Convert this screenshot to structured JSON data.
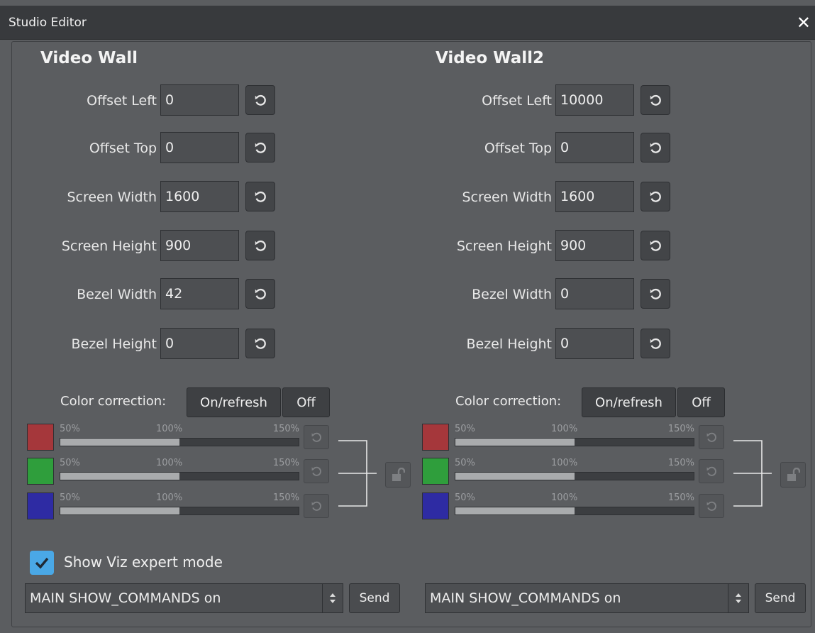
{
  "window": {
    "title": "Studio Editor",
    "close_icon": "close-icon"
  },
  "walls": [
    {
      "heading": "Video Wall",
      "fields": [
        {
          "label": "Offset Left",
          "value": "0"
        },
        {
          "label": "Offset Top",
          "value": "0"
        },
        {
          "label": "Screen Width",
          "value": "1600"
        },
        {
          "label": "Screen Height",
          "value": "900"
        },
        {
          "label": "Bezel Width",
          "value": "42"
        },
        {
          "label": "Bezel Height",
          "value": "0"
        }
      ],
      "color_correction": {
        "label": "Color correction:",
        "on_label": "On/refresh",
        "off_label": "Off",
        "channels": [
          {
            "color": "#a5373b",
            "ticks": [
              "50%",
              "100%",
              "150%"
            ],
            "value_pct": 100
          },
          {
            "color": "#2f9e3c",
            "ticks": [
              "50%",
              "100%",
              "150%"
            ],
            "value_pct": 100
          },
          {
            "color": "#2e2ba3",
            "ticks": [
              "50%",
              "100%",
              "150%"
            ],
            "value_pct": 100
          }
        ]
      },
      "command": {
        "value": "MAIN SHOW_COMMANDS on",
        "send_label": "Send"
      }
    },
    {
      "heading": "Video Wall2",
      "fields": [
        {
          "label": "Offset Left",
          "value": "10000"
        },
        {
          "label": "Offset Top",
          "value": "0"
        },
        {
          "label": "Screen Width",
          "value": "1600"
        },
        {
          "label": "Screen Height",
          "value": "900"
        },
        {
          "label": "Bezel Width",
          "value": "0"
        },
        {
          "label": "Bezel Height",
          "value": "0"
        }
      ],
      "color_correction": {
        "label": "Color correction:",
        "on_label": "On/refresh",
        "off_label": "Off",
        "channels": [
          {
            "color": "#a5373b",
            "ticks": [
              "50%",
              "100%",
              "150%"
            ],
            "value_pct": 100
          },
          {
            "color": "#2f9e3c",
            "ticks": [
              "50%",
              "100%",
              "150%"
            ],
            "value_pct": 100
          },
          {
            "color": "#2e2ba3",
            "ticks": [
              "50%",
              "100%",
              "150%"
            ],
            "value_pct": 100
          }
        ]
      },
      "command": {
        "value": "MAIN SHOW_COMMANDS on",
        "send_label": "Send"
      }
    }
  ],
  "expert_mode": {
    "label": "Show Viz expert mode",
    "checked": true
  },
  "colors": {
    "checkbox_accent": "#4aa8e6",
    "background": "#5b5d60"
  }
}
